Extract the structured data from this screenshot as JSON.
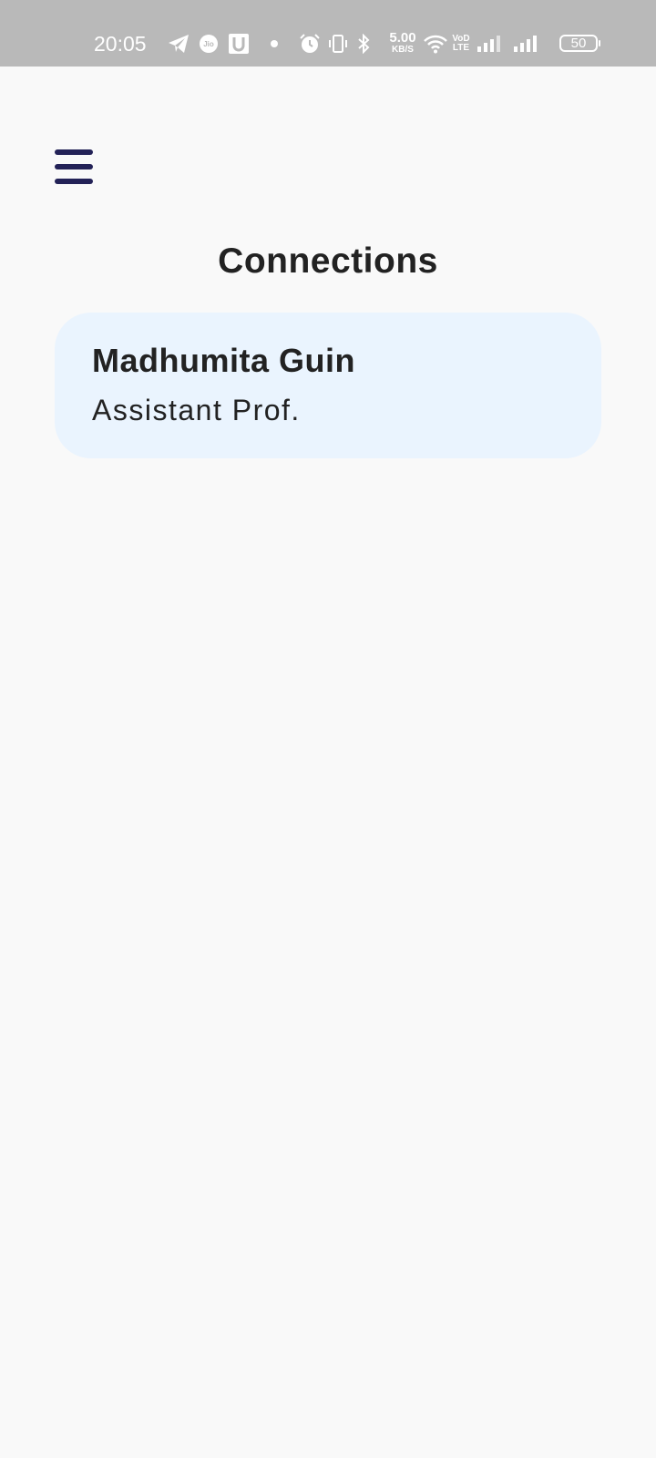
{
  "status_bar": {
    "time": "20:05",
    "network_speed_value": "5.00",
    "network_speed_unit": "KB/S",
    "network_type": [
      "VoD",
      "LTE"
    ],
    "battery_level": "50",
    "icons": [
      "telegram-icon",
      "jio-icon",
      "u-app-icon",
      "notification-dot-icon",
      "alarm-icon",
      "vibrate-icon",
      "bluetooth-icon",
      "wifi-icon",
      "signal-icon",
      "signal-icon",
      "battery-icon"
    ],
    "background_color": "#b9b9b9"
  },
  "header": {
    "menu_icon": "hamburger-menu-icon",
    "title": "Connections"
  },
  "connections": [
    {
      "name": "Madhumita Guin",
      "role": "Assistant Prof."
    }
  ],
  "colors": {
    "page_background": "#f9f9f9",
    "card_background": "#eaf4fe",
    "menu_icon": "#232257",
    "text": "#222222"
  }
}
